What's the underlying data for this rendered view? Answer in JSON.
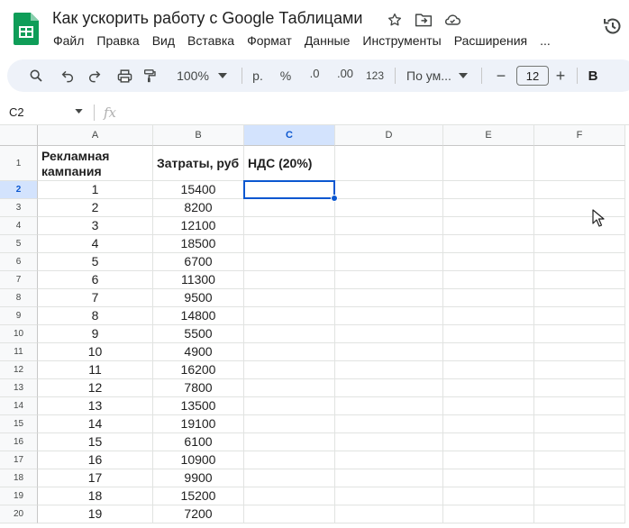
{
  "app": {
    "title": "Как ускорить работу с Google Таблицами",
    "accent_color": "#0b57d0",
    "logo_color": "#0f9d58",
    "icons": [
      "star-icon",
      "move-folder-icon",
      "cloud-saved-icon",
      "version-history-icon"
    ]
  },
  "menu": [
    "Файл",
    "Правка",
    "Вид",
    "Вставка",
    "Формат",
    "Данные",
    "Инструменты",
    "Расширения",
    "..."
  ],
  "toolbar": {
    "zoom": "100%",
    "currency": "р.",
    "percent": "%",
    "decrease_decimals": ".0",
    "increase_decimals": ".00",
    "more_formats": "123",
    "font": "По ум...",
    "font_size": "12",
    "bold": "B",
    "minus": "−",
    "plus": "+"
  },
  "formula_bar": {
    "name_box": "C2",
    "fx": "fx",
    "value": ""
  },
  "sheet": {
    "columns": [
      "A",
      "B",
      "C",
      "D",
      "E",
      "F"
    ],
    "active_column": "C",
    "active_row": "2",
    "row_numbers": [
      "1",
      "2",
      "3",
      "4",
      "5",
      "6",
      "7",
      "8",
      "9",
      "10",
      "11",
      "12",
      "13",
      "14",
      "15",
      "16",
      "17",
      "18",
      "19",
      "20"
    ],
    "header": {
      "a": "Рекламная кампания",
      "b": "Затраты, руб",
      "c": "НДС (20%)"
    },
    "rows": [
      {
        "a": "1",
        "b": "15400"
      },
      {
        "a": "2",
        "b": "8200"
      },
      {
        "a": "3",
        "b": "12100"
      },
      {
        "a": "4",
        "b": "18500"
      },
      {
        "a": "5",
        "b": "6700"
      },
      {
        "a": "6",
        "b": "11300"
      },
      {
        "a": "7",
        "b": "9500"
      },
      {
        "a": "8",
        "b": "14800"
      },
      {
        "a": "9",
        "b": "5500"
      },
      {
        "a": "10",
        "b": "4900"
      },
      {
        "a": "11",
        "b": "16200"
      },
      {
        "a": "12",
        "b": "7800"
      },
      {
        "a": "13",
        "b": "13500"
      },
      {
        "a": "14",
        "b": "19100"
      },
      {
        "a": "15",
        "b": "6100"
      },
      {
        "a": "16",
        "b": "10900"
      },
      {
        "a": "17",
        "b": "9900"
      },
      {
        "a": "18",
        "b": "15200"
      },
      {
        "a": "19",
        "b": "7200"
      }
    ]
  }
}
